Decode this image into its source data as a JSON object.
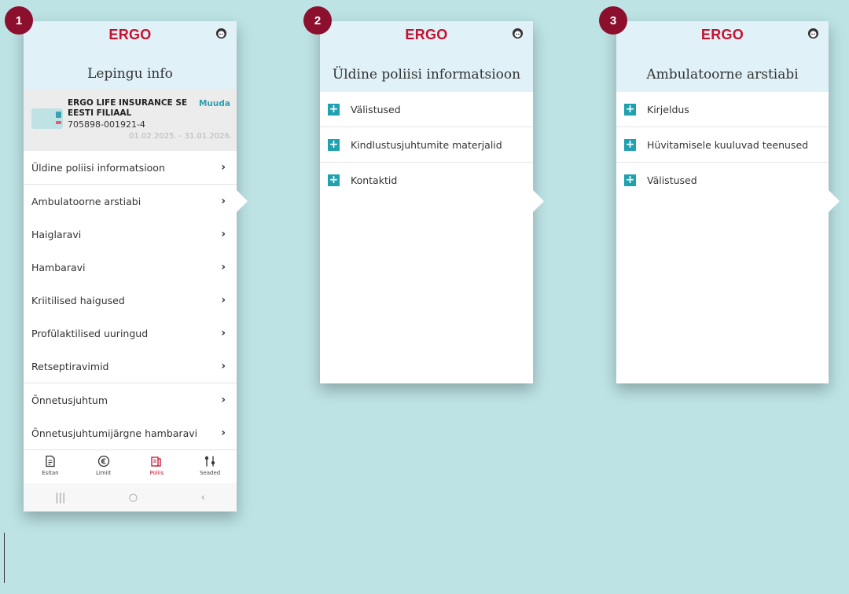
{
  "colors": {
    "brand": "#c8102e",
    "accent": "#1fa1b0",
    "badge": "#8c0f2e",
    "background": "#bde3e5"
  },
  "badges": [
    "1",
    "2",
    "3"
  ],
  "logo": "ERGO",
  "screen1": {
    "title": "Lepingu info",
    "contract": {
      "insurer": "ERGO LIFE INSURANCE SE EESTI FILIAAL",
      "policy_number": "705898-001921-4",
      "period": "01.02.2025. - 31.01.2026.",
      "change_label": "Muuda"
    },
    "menu": [
      "Üldine poliisi informatsioon",
      "Ambulatoorne arstiabi",
      "Haiglaravi",
      "Hambaravi",
      "Kriitilised haigused",
      "Profülaktilised uuringud",
      "Retseptiravimid",
      "Õnnetusjuhtum",
      "Õnnetusjuhtumijärgne hambaravi"
    ],
    "chevron": "›",
    "tabs": [
      {
        "label": "Esitan",
        "icon": "document-icon"
      },
      {
        "label": "Limiit",
        "icon": "euro-icon"
      },
      {
        "label": "Poliis",
        "icon": "policy-icon",
        "active": true
      },
      {
        "label": "Seaded",
        "icon": "settings-icon"
      }
    ],
    "system_nav": [
      "|||",
      "○",
      "‹"
    ]
  },
  "screen2": {
    "title": "Üldine poliisi informatsioon",
    "items": [
      "Välistused",
      "Kindlustusjuhtumite materjalid",
      "Kontaktid"
    ]
  },
  "screen3": {
    "title": "Ambulatoorne arstiabi",
    "items": [
      "Kirjeldus",
      "Hüvitamisele kuuluvad teenused",
      "Välistused"
    ]
  },
  "plus_symbol": "+"
}
